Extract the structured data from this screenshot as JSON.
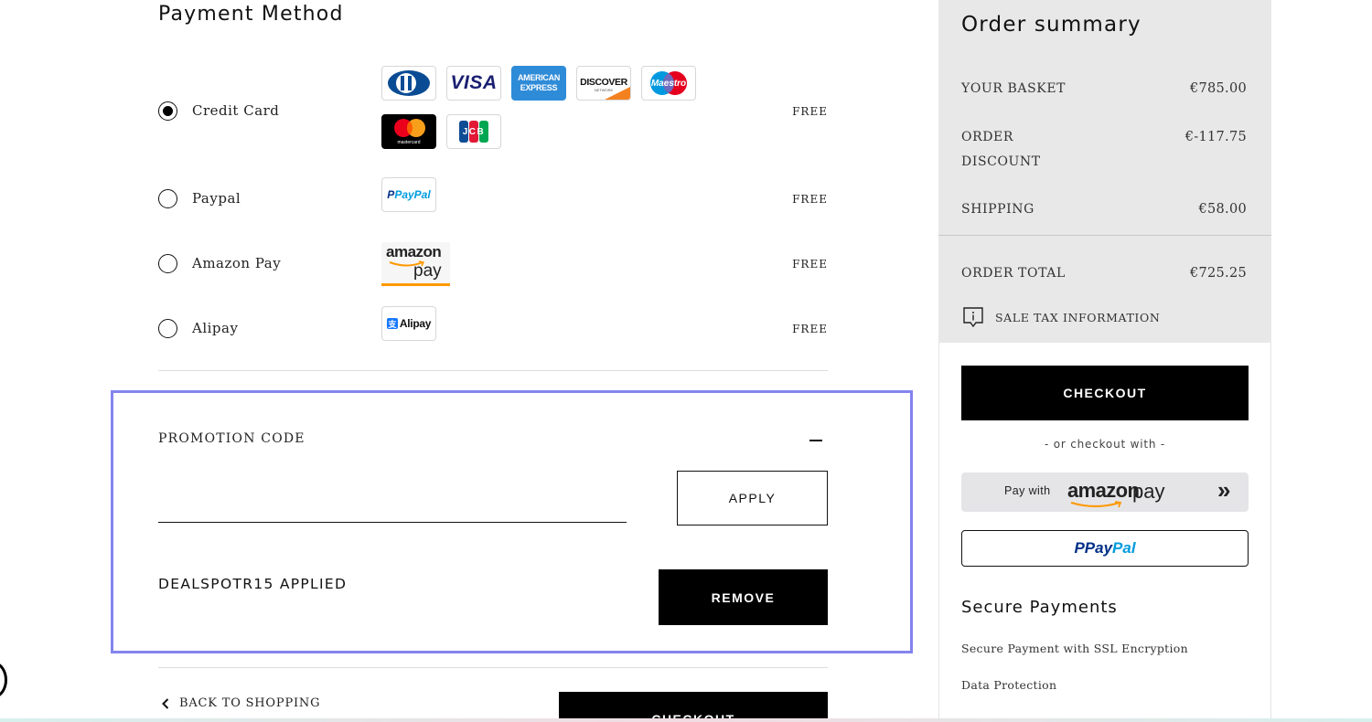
{
  "payment": {
    "title": "Payment Method",
    "methods": [
      {
        "label": "Credit Card",
        "cost": "FREE",
        "selected": true
      },
      {
        "label": "Paypal",
        "cost": "FREE",
        "selected": false
      },
      {
        "label": "Amazon Pay",
        "cost": "FREE",
        "selected": false
      },
      {
        "label": "Alipay",
        "cost": "FREE",
        "selected": false
      }
    ],
    "card_logos": {
      "diners": "diners-club-icon",
      "visa": "VISA",
      "amex_line1": "AMERICAN",
      "amex_line2": "EXPRESS",
      "discover": "DISCOVER",
      "discover_sub": "NETWORK",
      "maestro": "Maestro",
      "mastercard": "mastercard",
      "jcb": "JCB",
      "paypal_small": "PayPal",
      "amazon_word": "amazon",
      "amazon_pay": "pay",
      "alipay": "Alipay"
    }
  },
  "promo": {
    "title": "PROMOTION CODE",
    "input_value": "",
    "input_placeholder": "",
    "apply_label": "APPLY",
    "applied_text": "DEALSPOTR15 APPLIED",
    "remove_label": "REMOVE"
  },
  "footer": {
    "back_label": "BACK TO SHOPPING",
    "checkout_label": "CHECKOUT"
  },
  "summary": {
    "title": "Order summary",
    "rows": [
      {
        "label": "YOUR BASKET",
        "value": "€785.00"
      },
      {
        "label_line1": "ORDER",
        "label_line2": "DISCOUNT",
        "value": "€-117.75"
      },
      {
        "label": "SHIPPING",
        "value": "€58.00"
      }
    ],
    "total_label": "ORDER TOTAL",
    "total_value": "€725.25",
    "tax_label": "SALE TAX INFORMATION",
    "checkout_label": "CHECKOUT",
    "or_text": "- or checkout with -",
    "amazon_pay_with": "Pay with",
    "amazon_word": "amazon",
    "amazon_pay": "pay",
    "paypal_p": "Pay",
    "paypal_pal": "Pal",
    "secure_title": "Secure Payments",
    "secure_items": [
      "Secure Payment with SSL Encryption",
      "Data Protection"
    ]
  },
  "colors": {
    "accent_border": "#8484ee",
    "summary_bg": "#e8e8e8",
    "paypal_dark": "#003087",
    "paypal_light": "#009cde",
    "amazon_orange": "#ff9900"
  }
}
